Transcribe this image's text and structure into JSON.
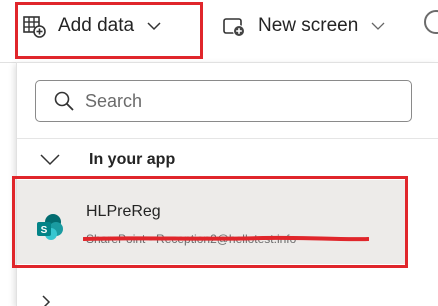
{
  "toolbar": {
    "add_data_label": "Add data",
    "new_screen_label": "New screen"
  },
  "dropdown": {
    "search_placeholder": "Search",
    "section_label": "In your app",
    "items": [
      {
        "title": "HLPreReg",
        "subtitle": "SharePoint - Reception2@hellotest.info"
      }
    ]
  },
  "colors": {
    "highlight": "#e0262b",
    "selected_row": "#edebe9",
    "sharepoint": "#038387"
  }
}
